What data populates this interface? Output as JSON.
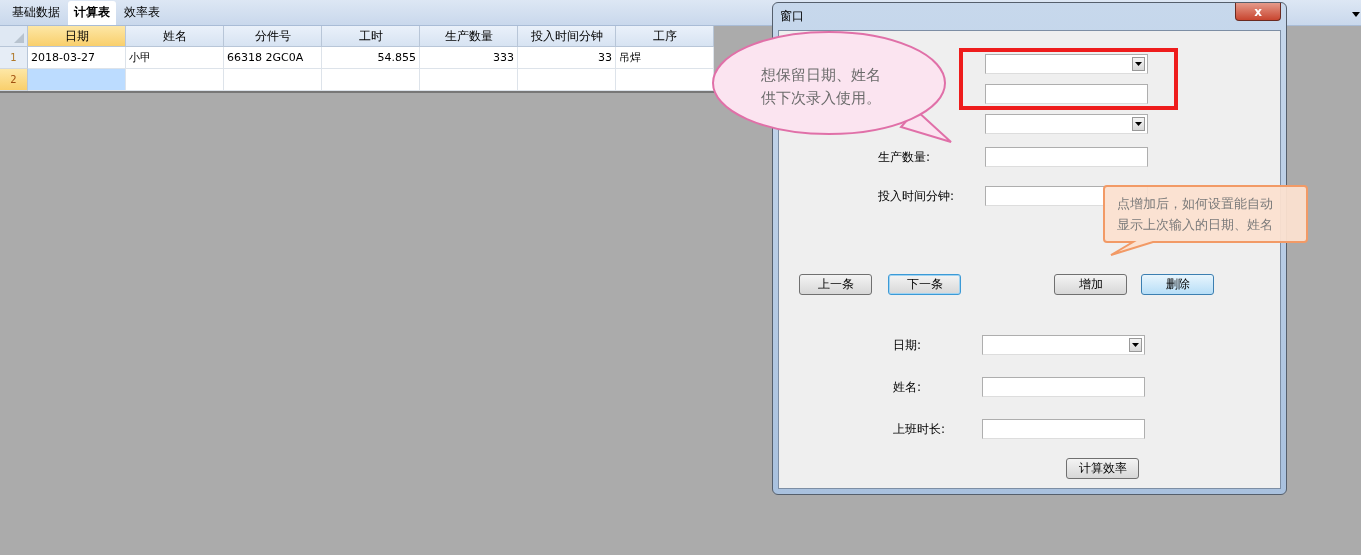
{
  "app_tabs": [
    {
      "label": "基础数据",
      "selected": false
    },
    {
      "label": "计算表",
      "selected": true
    },
    {
      "label": "效率表",
      "selected": false
    }
  ],
  "sheet": {
    "columns": [
      {
        "label": "日期",
        "kind": "text",
        "selected": true
      },
      {
        "label": "姓名",
        "kind": "text",
        "selected": false
      },
      {
        "label": "分件号",
        "kind": "text",
        "selected": false
      },
      {
        "label": "工时",
        "kind": "number",
        "selected": false
      },
      {
        "label": "生产数量",
        "kind": "number",
        "selected": false
      },
      {
        "label": "投入时间分钟",
        "kind": "number",
        "selected": false
      },
      {
        "label": "工序",
        "kind": "text",
        "selected": false
      }
    ],
    "rows": [
      {
        "number": "1",
        "selected": false,
        "cells": [
          {
            "text": "2018-03-27",
            "selected": false
          },
          {
            "text": "小甲",
            "selected": false
          },
          {
            "text": "66318 2GC0A",
            "selected": false
          },
          {
            "text": "54.855",
            "selected": false
          },
          {
            "text": "333",
            "selected": false
          },
          {
            "text": "33",
            "selected": false
          },
          {
            "text": "吊焊",
            "selected": false
          }
        ]
      },
      {
        "number": "2",
        "selected": true,
        "cells": [
          {
            "selected": true
          },
          {
            "selected": false
          },
          {
            "selected": false
          },
          {
            "selected": false
          },
          {
            "selected": false
          },
          {
            "selected": false
          },
          {
            "selected": false
          }
        ]
      }
    ]
  },
  "dialog": {
    "title": "窗口",
    "close_label": "x",
    "fields": [
      {
        "kind": "combo",
        "highlighted": true
      },
      {
        "kind": "text",
        "highlighted": true
      },
      {
        "kind": "combo",
        "highlighted": false
      },
      {
        "label": "生产数量:",
        "kind": "text",
        "highlighted": false
      },
      {
        "label": "投入时间分钟:",
        "kind": "text",
        "highlighted": false
      }
    ],
    "nav_buttons": [
      {
        "label": "上一条",
        "focused": false,
        "hovered": false
      },
      {
        "label": "下一条",
        "focused": true,
        "hovered": false
      }
    ],
    "action_buttons": [
      {
        "label": "增加",
        "focused": false,
        "hovered": false
      },
      {
        "label": "删除",
        "focused": false,
        "hovered": true
      }
    ],
    "summary_fields": [
      {
        "label": "日期:",
        "kind": "combo"
      },
      {
        "label": "姓名:",
        "kind": "text"
      },
      {
        "label": "上班时长:",
        "kind": "text"
      }
    ],
    "calc_button": "计算效率"
  },
  "callouts": [
    {
      "kind": "ellipse",
      "lines": [
        "想保留日期、姓名",
        "供下次录入使用。"
      ]
    },
    {
      "kind": "rect",
      "lines": [
        "点增加后，如何设置能自动",
        "显示上次输入的日期、姓名"
      ]
    }
  ]
}
